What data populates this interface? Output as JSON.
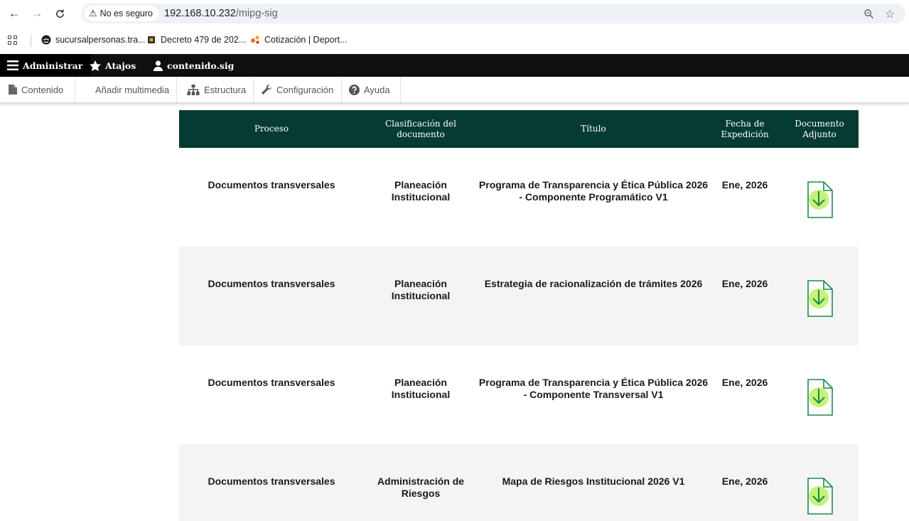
{
  "browser": {
    "security_label": "No es seguro",
    "url_host": "192.168.10.232",
    "url_path": "/mipg-sig",
    "icons": [
      "back-icon",
      "forward-icon",
      "reload-icon",
      "warning-icon",
      "zoom-icon",
      "star-icon"
    ]
  },
  "bookmarks": [
    {
      "label": "sucursalpersonas.tra...",
      "icon": "globe-icon"
    },
    {
      "label": "Decreto 479 de 202...",
      "icon": "seal-icon"
    },
    {
      "label": "Cotización | Deport...",
      "icon": "dots-icon"
    }
  ],
  "toolbar": {
    "admin_label": "Administrar",
    "shortcuts_label": "Atajos",
    "user_label": "contenido.sig"
  },
  "tray": {
    "items": [
      {
        "label": "Contenido",
        "icon": "file-icon"
      },
      {
        "label": "Añadir multimedia",
        "icon": ""
      },
      {
        "label": "Estructura",
        "icon": "sitemap-icon"
      },
      {
        "label": "Configuración",
        "icon": "wrench-icon"
      },
      {
        "label": "Ayuda",
        "icon": "help-icon"
      }
    ]
  },
  "table": {
    "headers": [
      "Proceso",
      "Clasificación del documento",
      "Título",
      "Fecha de Expedición",
      "Documento Adjunto"
    ],
    "rows": [
      {
        "proceso": "Documentos transversales",
        "clasificacion": "Planeación Institucional",
        "titulo": "Programa de Transparencia y Ética Pública 2026 - Componente Programático V1",
        "fecha": "Ene, 2026"
      },
      {
        "proceso": "Documentos transversales",
        "clasificacion": "Planeación Institucional",
        "titulo": "Estrategia de racionalización de trámites 2026",
        "fecha": "Ene, 2026"
      },
      {
        "proceso": "Documentos transversales",
        "clasificacion": "Planeación Institucional",
        "titulo": "Programa de Transparencia y Ética Pública 2026 - Componente Transversal V1",
        "fecha": "Ene, 2026"
      },
      {
        "proceso": "Documentos transversales",
        "clasificacion": "Administración de Riesgos",
        "titulo": "Mapa de Riesgos Institucional 2026 V1",
        "fecha": "Ene, 2026"
      }
    ]
  },
  "colors": {
    "header_bg": "#053b33",
    "toolbar_bg": "#0f0f0f",
    "icon_green": "#c6f27a",
    "icon_stroke": "#1a8a4a"
  }
}
